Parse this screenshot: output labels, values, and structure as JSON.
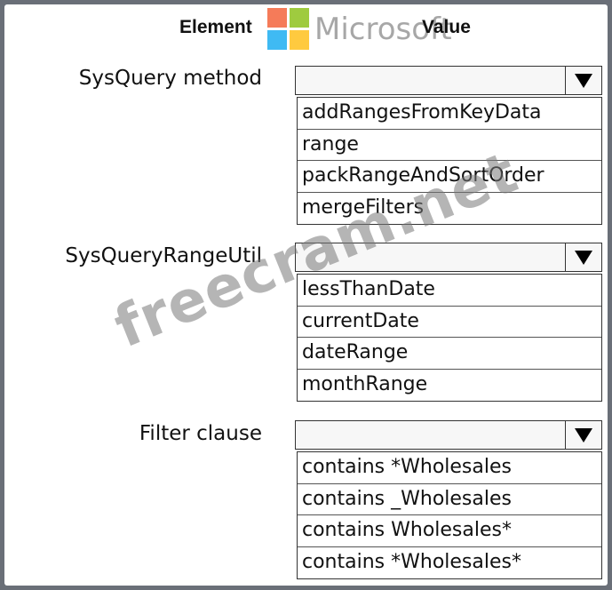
{
  "headers": {
    "element": "Element",
    "value": "Value"
  },
  "logo": {
    "text": "Microsoft",
    "colors": [
      "#f25022",
      "#7fba00",
      "#00a4ef",
      "#ffb900"
    ]
  },
  "watermark": "freecram.net",
  "rows": [
    {
      "label": "SysQuery method",
      "selected": "",
      "options": [
        "addRangesFromKeyData",
        "range",
        "packRangeAndSortOrder",
        "mergeFilters"
      ]
    },
    {
      "label": "SysQueryRangeUtil",
      "selected": "",
      "options": [
        "lessThanDate",
        "currentDate",
        "dateRange",
        "monthRange"
      ]
    },
    {
      "label": "Filter clause",
      "selected": "",
      "options": [
        "contains *Wholesales",
        "contains _Wholesales",
        "contains Wholesales*",
        "contains *Wholesales*"
      ]
    }
  ]
}
